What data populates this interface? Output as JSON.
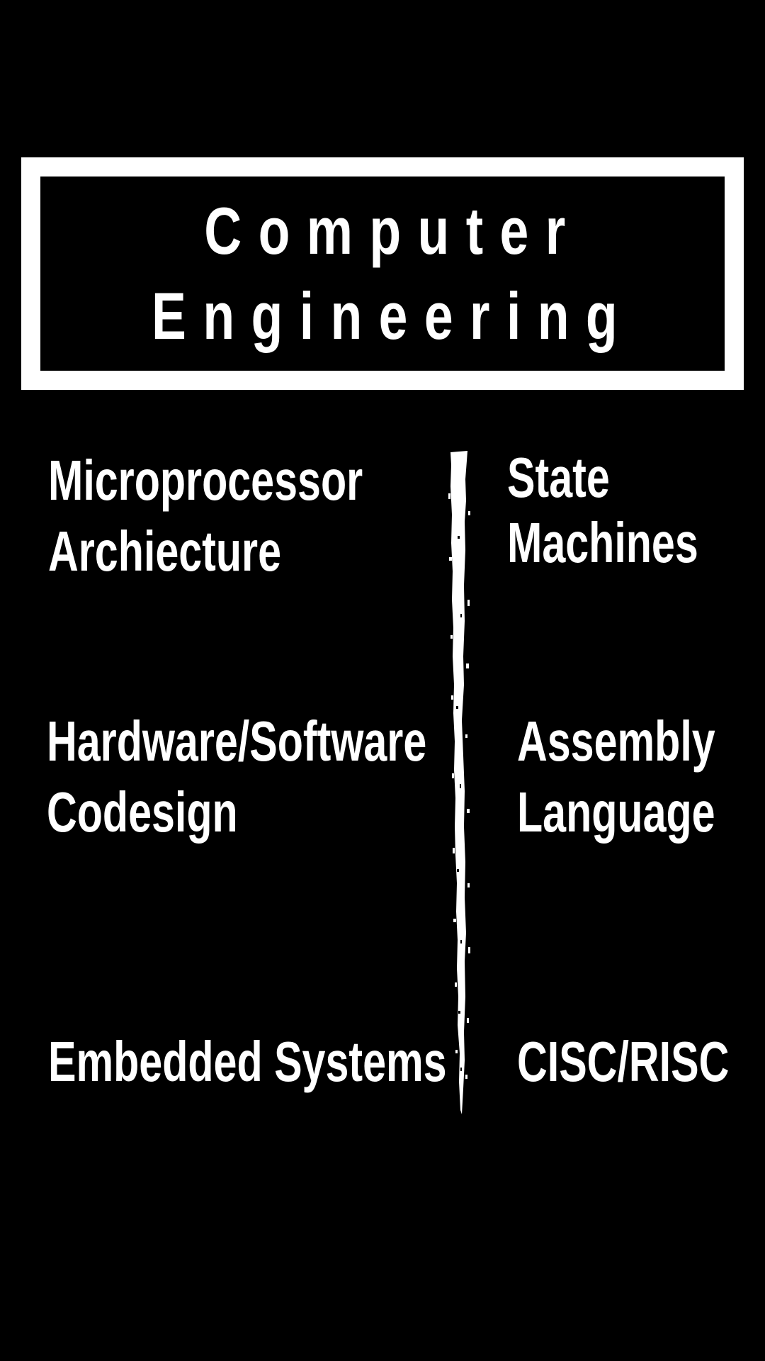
{
  "title": {
    "line1": "Computer",
    "line2": "Engineering"
  },
  "topics": {
    "left": [
      {
        "line1": "Microprocessor",
        "line2": "Archiecture"
      },
      {
        "line1": "Hardware/Software",
        "line2": "Codesign"
      },
      {
        "line1": "Embedded Systems",
        "line2": ""
      }
    ],
    "right": [
      {
        "line1": "State",
        "line2": "Machines"
      },
      {
        "line1": "Assembly",
        "line2": "Language"
      },
      {
        "line1": "CISC/RISC",
        "line2": ""
      }
    ]
  },
  "colors": {
    "background": "#000000",
    "foreground": "#ffffff"
  }
}
